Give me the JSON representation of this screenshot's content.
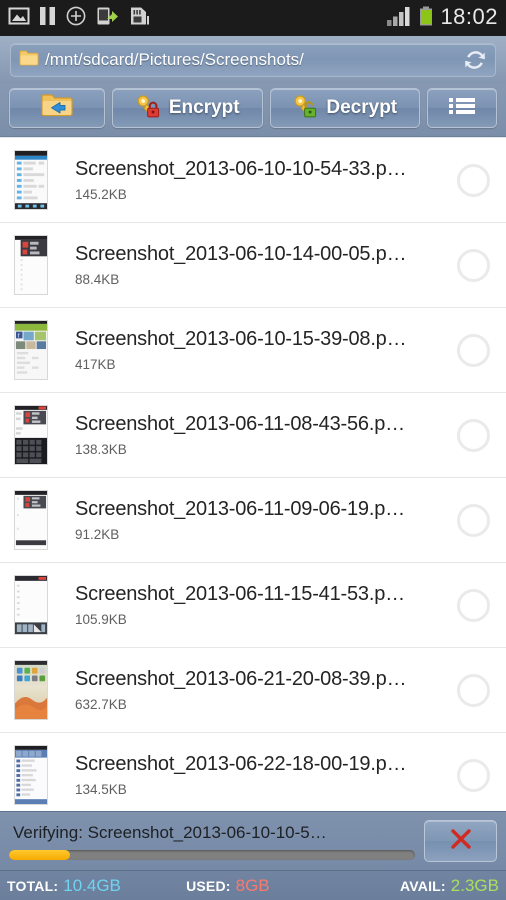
{
  "statusbar": {
    "time": "18:02",
    "icons": [
      {
        "name": "gallery-image-icon",
        "label": "Gallery"
      },
      {
        "name": "pause-icon",
        "label": "Paused"
      },
      {
        "name": "plus-circle-icon",
        "label": "Add"
      },
      {
        "name": "device-transfer-icon",
        "label": "USB transfer"
      },
      {
        "name": "sd-card-icon",
        "label": "SD card"
      }
    ],
    "signal": {
      "name": "signal-bars-icon",
      "bars": 4
    },
    "battery": {
      "name": "battery-icon",
      "color": "#8cc417"
    }
  },
  "pathbar": {
    "folder_icon": "folder-icon",
    "path": "/mnt/sdcard/Pictures/Screenshots/",
    "refresh_icon": "refresh-icon"
  },
  "toolbar": {
    "back_label": "",
    "back_icon": "folder-back-icon",
    "encrypt_label": "Encrypt",
    "encrypt_icon": "key-lock-closed-icon",
    "decrypt_label": "Decrypt",
    "decrypt_icon": "key-lock-open-icon",
    "menu_icon": "list-menu-icon"
  },
  "files": [
    {
      "name": "Screenshot_2013-06-10-10-54-33.p…",
      "size": "145.2KB",
      "selected": false,
      "thumb": "list-ui"
    },
    {
      "name": "Screenshot_2013-06-10-14-00-05.p…",
      "size": "88.4KB",
      "selected": false,
      "thumb": "dark-top"
    },
    {
      "name": "Screenshot_2013-06-10-15-39-08.p…",
      "size": "417KB",
      "selected": false,
      "thumb": "social"
    },
    {
      "name": "Screenshot_2013-06-11-08-43-56.p…",
      "size": "138.3KB",
      "selected": false,
      "thumb": "keyboard"
    },
    {
      "name": "Screenshot_2013-06-11-09-06-19.p…",
      "size": "91.2KB",
      "selected": false,
      "thumb": "sparse"
    },
    {
      "name": "Screenshot_2013-06-11-15-41-53.p…",
      "size": "105.9KB",
      "selected": false,
      "thumb": "bottom-bar"
    },
    {
      "name": "Screenshot_2013-06-21-20-08-39.p…",
      "size": "632.7KB",
      "selected": false,
      "thumb": "homescreen"
    },
    {
      "name": "Screenshot_2013-06-22-18-00-19.p…",
      "size": "134.5KB",
      "selected": false,
      "thumb": "blue-list"
    }
  ],
  "progress": {
    "label": "Verifying: Screenshot_2013-06-10-10-5…",
    "percent": 15,
    "cancel_icon": "close-x-icon"
  },
  "storage": {
    "total_key": "TOTAL:",
    "total_value": "10.4GB",
    "used_key": "USED:",
    "used_value": "8GB",
    "avail_key": "AVAIL:",
    "avail_value": "2.3GB"
  }
}
